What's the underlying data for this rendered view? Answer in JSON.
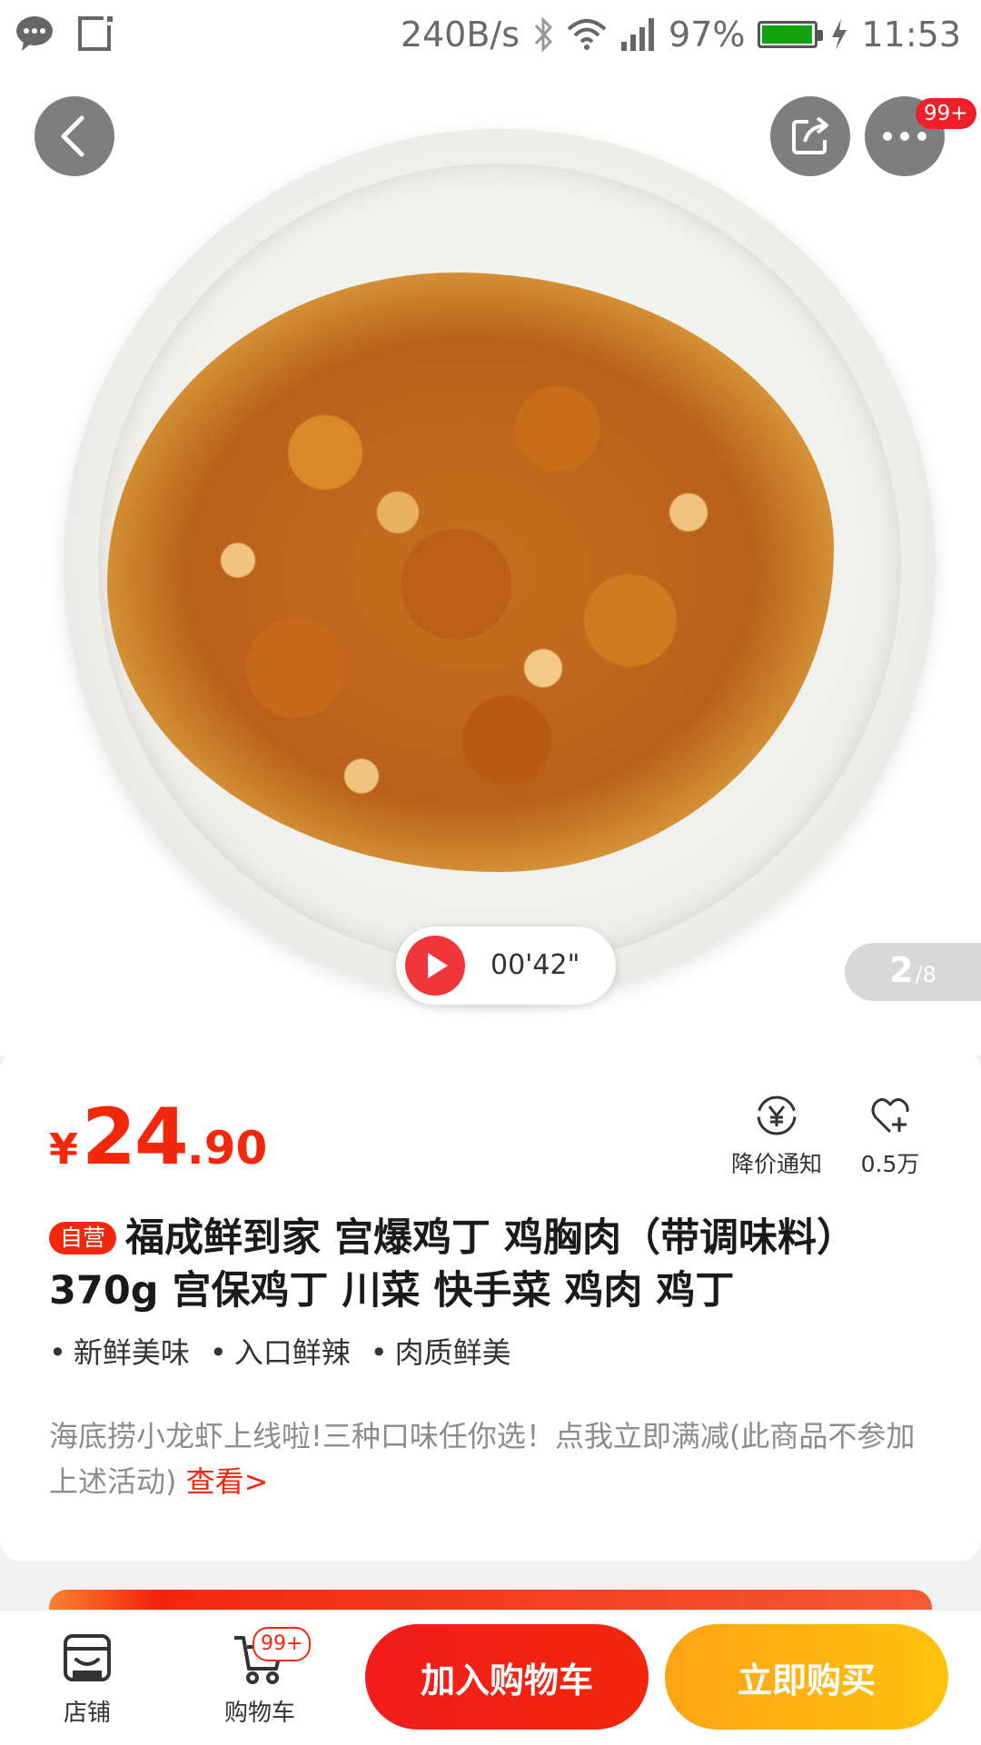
{
  "status_bar": {
    "speed": "240B/s",
    "battery_percent": "97%",
    "battery_level": 0.97,
    "time": "11:53"
  },
  "header": {
    "more_badge": "99+"
  },
  "gallery": {
    "video_duration": "00'42\"",
    "current_page": "2",
    "total_pages": "/8"
  },
  "product": {
    "price_symbol": "¥",
    "price_integer": "24",
    "price_decimal": ".90",
    "price_notify_label": "降价通知",
    "follow_count": "0.5万",
    "self_operated_tag": "自营",
    "title": "福成鲜到家 宫爆鸡丁 鸡胸肉（带调味料）370g 宫保鸡丁 川菜 快手菜 鸡肉 鸡丁",
    "tags": [
      "新鲜美味",
      "入口鲜辣",
      "肉质鲜美"
    ],
    "promo_text": "海底捞小龙虾上线啦!三种口味任你选！点我立即满减(此商品不参加上述活动) ",
    "promo_link": "查看>"
  },
  "bottom_bar": {
    "shop_label": "店铺",
    "cart_label": "购物车",
    "cart_badge": "99+",
    "add_to_cart": "加入购物车",
    "buy_now": "立即购买"
  },
  "colors": {
    "accent_red": "#f2270c",
    "buy_orange": "#ffb30f"
  }
}
